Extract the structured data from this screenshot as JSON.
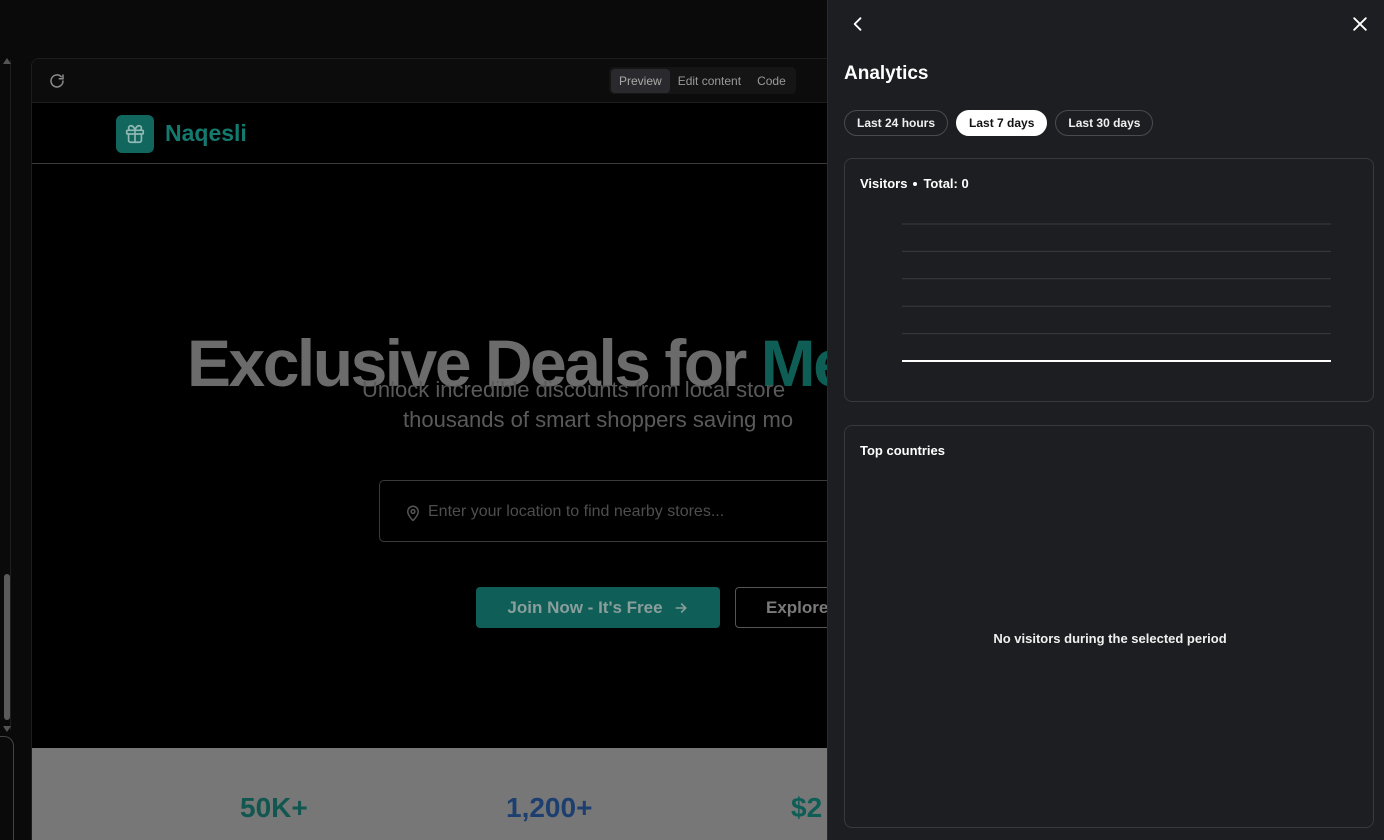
{
  "preview": {
    "tabs": [
      {
        "label": "Preview",
        "active": true
      },
      {
        "label": "Edit content",
        "active": false
      },
      {
        "label": "Code",
        "active": false
      }
    ]
  },
  "site": {
    "brand": "Naqesli",
    "hero_title_main": "Exclusive Deals for ",
    "hero_title_accent": "Me",
    "hero_sub_line1": "Unlock incredible discounts from local store",
    "hero_sub_line2": "thousands of smart shoppers saving mo",
    "location_placeholder": "Enter your location to find nearby stores...",
    "location_value": "",
    "join_label": "Join Now - It's Free",
    "explore_label": "Explore",
    "stats": [
      "50K+",
      "1,200+",
      "$2"
    ]
  },
  "analytics": {
    "title": "Analytics",
    "ranges": [
      {
        "label": "Last 24 hours",
        "active": false
      },
      {
        "label": "Last 7 days",
        "active": true
      },
      {
        "label": "Last 30 days",
        "active": false
      }
    ],
    "visitors_label": "Visitors",
    "total_label": "Total: 0",
    "countries_title": "Top countries",
    "empty_message": "No visitors during the selected period"
  },
  "chart_data": {
    "type": "line",
    "title": "",
    "series": [],
    "grid": true
  },
  "colors": {
    "brand_teal": "#11665e",
    "panel_bg": "#1d1e21",
    "active_pill": "#ffffff"
  },
  "icons": {
    "back": "chevron-left-icon",
    "close": "close-icon",
    "refresh": "refresh-icon",
    "logo": "gift-icon",
    "pin": "map-pin-icon",
    "arrow": "arrow-right-icon"
  }
}
